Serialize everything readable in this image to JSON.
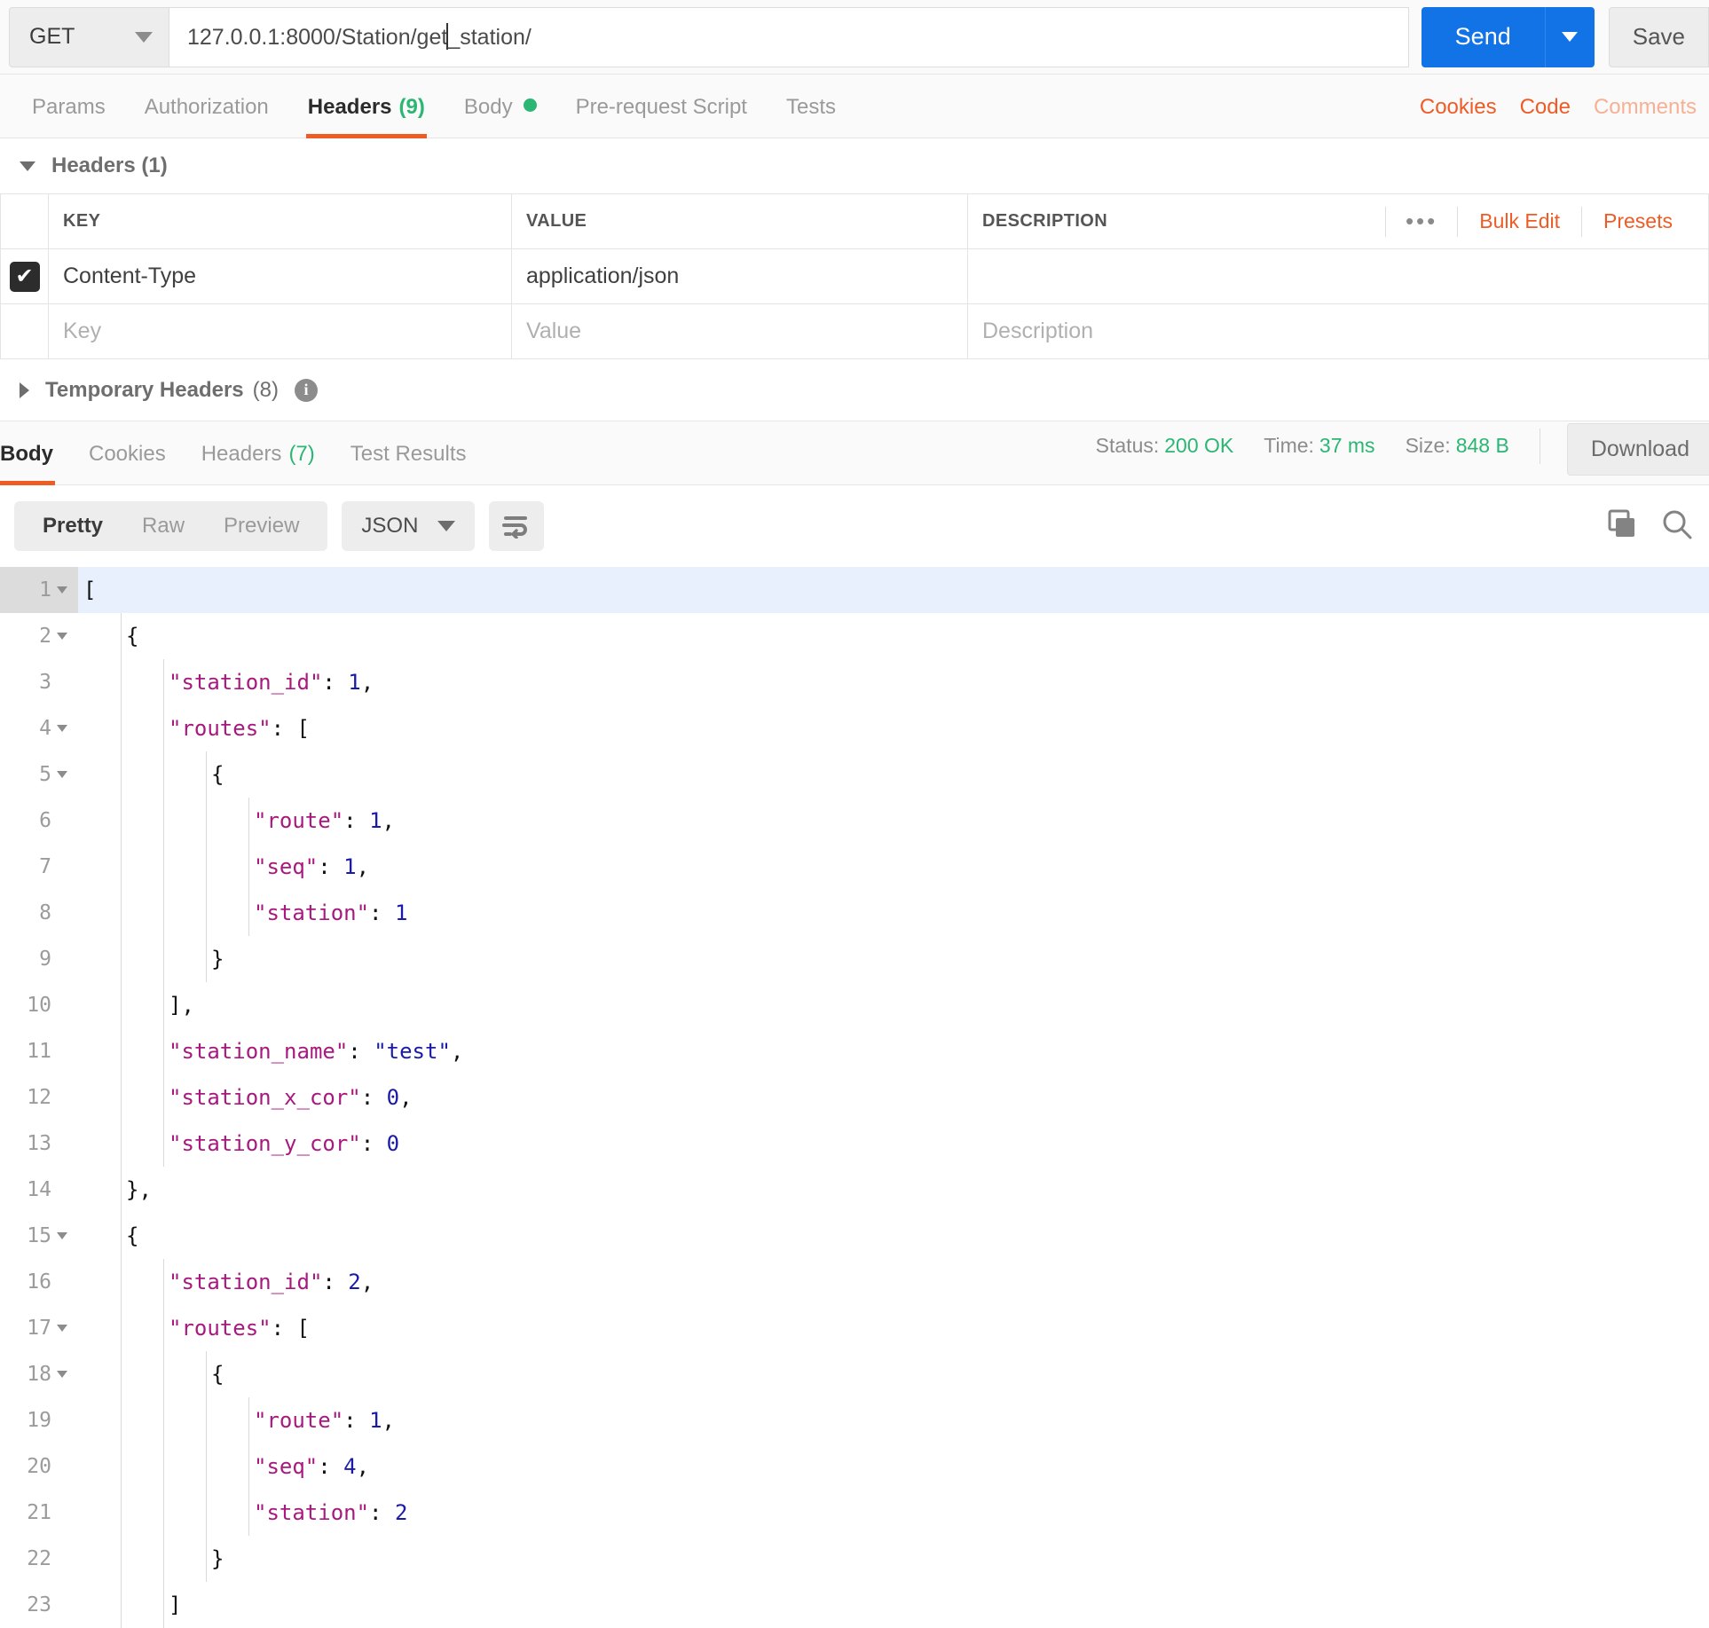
{
  "request": {
    "method": "GET",
    "url": "127.0.0.1:8000/Station/get_station/",
    "url_before_caret": "127.0.0.1:8000/Station/get",
    "url_after_caret": "_station/",
    "send_label": "Send",
    "save_label": "Save",
    "tabs": [
      {
        "label": "Params",
        "count": "",
        "active": false
      },
      {
        "label": "Authorization",
        "count": "",
        "active": false
      },
      {
        "label": "Headers",
        "count": "(9)",
        "active": true
      },
      {
        "label": "Body",
        "count": "",
        "active": false,
        "dot": true
      },
      {
        "label": "Pre-request Script",
        "count": "",
        "active": false
      },
      {
        "label": "Tests",
        "count": "",
        "active": false
      }
    ],
    "right_links": [
      {
        "label": "Cookies",
        "muted": false
      },
      {
        "label": "Code",
        "muted": false
      },
      {
        "label": "Comments",
        "muted": true
      }
    ]
  },
  "headers_section": {
    "title": "Headers (1)",
    "columns": [
      "KEY",
      "VALUE",
      "DESCRIPTION"
    ],
    "actions": {
      "more": "•••",
      "bulk_edit": "Bulk Edit",
      "presets": "Presets"
    },
    "rows": [
      {
        "checked": true,
        "key": "Content-Type",
        "value": "application/json",
        "description": ""
      }
    ],
    "placeholder_row": {
      "key": "Key",
      "value": "Value",
      "description": "Description"
    },
    "temporary_headers": {
      "label": "Temporary Headers",
      "count": "(8)"
    }
  },
  "response": {
    "tabs": [
      {
        "label": "Body",
        "count": "",
        "active": true
      },
      {
        "label": "Cookies",
        "count": "",
        "active": false
      },
      {
        "label": "Headers",
        "count": "(7)",
        "active": false
      },
      {
        "label": "Test Results",
        "count": "",
        "active": false
      }
    ],
    "meta": {
      "status_label": "Status:",
      "status_value": "200 OK",
      "time_label": "Time:",
      "time_value": "37 ms",
      "size_label": "Size:",
      "size_value": "848 B"
    },
    "download_label": "Download",
    "format_tabs": [
      {
        "label": "Pretty",
        "active": true
      },
      {
        "label": "Raw",
        "active": false
      },
      {
        "label": "Preview",
        "active": false
      }
    ],
    "language": "JSON",
    "accent_orange": "#ef5b25",
    "accent_blue": "#1173e6",
    "accent_green": "#2bb673",
    "body_lines": [
      {
        "num": "1",
        "fold": true,
        "highlight": true,
        "indent": 0,
        "tokens": [
          {
            "t": "[",
            "c": "p"
          }
        ]
      },
      {
        "num": "2",
        "fold": true,
        "highlight": false,
        "indent": 1,
        "tokens": [
          {
            "t": "{",
            "c": "p"
          }
        ]
      },
      {
        "num": "3",
        "fold": false,
        "highlight": false,
        "indent": 2,
        "tokens": [
          {
            "t": "\"station_id\"",
            "c": "k"
          },
          {
            "t": ": ",
            "c": "p"
          },
          {
            "t": "1",
            "c": "n"
          },
          {
            "t": ",",
            "c": "p"
          }
        ]
      },
      {
        "num": "4",
        "fold": true,
        "highlight": false,
        "indent": 2,
        "tokens": [
          {
            "t": "\"routes\"",
            "c": "k"
          },
          {
            "t": ": [",
            "c": "p"
          }
        ]
      },
      {
        "num": "5",
        "fold": true,
        "highlight": false,
        "indent": 3,
        "tokens": [
          {
            "t": "{",
            "c": "p"
          }
        ]
      },
      {
        "num": "6",
        "fold": false,
        "highlight": false,
        "indent": 4,
        "tokens": [
          {
            "t": "\"route\"",
            "c": "k"
          },
          {
            "t": ": ",
            "c": "p"
          },
          {
            "t": "1",
            "c": "n"
          },
          {
            "t": ",",
            "c": "p"
          }
        ]
      },
      {
        "num": "7",
        "fold": false,
        "highlight": false,
        "indent": 4,
        "tokens": [
          {
            "t": "\"seq\"",
            "c": "k"
          },
          {
            "t": ": ",
            "c": "p"
          },
          {
            "t": "1",
            "c": "n"
          },
          {
            "t": ",",
            "c": "p"
          }
        ]
      },
      {
        "num": "8",
        "fold": false,
        "highlight": false,
        "indent": 4,
        "tokens": [
          {
            "t": "\"station\"",
            "c": "k"
          },
          {
            "t": ": ",
            "c": "p"
          },
          {
            "t": "1",
            "c": "n"
          }
        ]
      },
      {
        "num": "9",
        "fold": false,
        "highlight": false,
        "indent": 3,
        "tokens": [
          {
            "t": "}",
            "c": "p"
          }
        ]
      },
      {
        "num": "10",
        "fold": false,
        "highlight": false,
        "indent": 2,
        "tokens": [
          {
            "t": "],",
            "c": "p"
          }
        ]
      },
      {
        "num": "11",
        "fold": false,
        "highlight": false,
        "indent": 2,
        "tokens": [
          {
            "t": "\"station_name\"",
            "c": "k"
          },
          {
            "t": ": ",
            "c": "p"
          },
          {
            "t": "\"test\"",
            "c": "s"
          },
          {
            "t": ",",
            "c": "p"
          }
        ]
      },
      {
        "num": "12",
        "fold": false,
        "highlight": false,
        "indent": 2,
        "tokens": [
          {
            "t": "\"station_x_cor\"",
            "c": "k"
          },
          {
            "t": ": ",
            "c": "p"
          },
          {
            "t": "0",
            "c": "n"
          },
          {
            "t": ",",
            "c": "p"
          }
        ]
      },
      {
        "num": "13",
        "fold": false,
        "highlight": false,
        "indent": 2,
        "tokens": [
          {
            "t": "\"station_y_cor\"",
            "c": "k"
          },
          {
            "t": ": ",
            "c": "p"
          },
          {
            "t": "0",
            "c": "n"
          }
        ]
      },
      {
        "num": "14",
        "fold": false,
        "highlight": false,
        "indent": 1,
        "tokens": [
          {
            "t": "},",
            "c": "p"
          }
        ]
      },
      {
        "num": "15",
        "fold": true,
        "highlight": false,
        "indent": 1,
        "tokens": [
          {
            "t": "{",
            "c": "p"
          }
        ]
      },
      {
        "num": "16",
        "fold": false,
        "highlight": false,
        "indent": 2,
        "tokens": [
          {
            "t": "\"station_id\"",
            "c": "k"
          },
          {
            "t": ": ",
            "c": "p"
          },
          {
            "t": "2",
            "c": "n"
          },
          {
            "t": ",",
            "c": "p"
          }
        ]
      },
      {
        "num": "17",
        "fold": true,
        "highlight": false,
        "indent": 2,
        "tokens": [
          {
            "t": "\"routes\"",
            "c": "k"
          },
          {
            "t": ": [",
            "c": "p"
          }
        ]
      },
      {
        "num": "18",
        "fold": true,
        "highlight": false,
        "indent": 3,
        "tokens": [
          {
            "t": "{",
            "c": "p"
          }
        ]
      },
      {
        "num": "19",
        "fold": false,
        "highlight": false,
        "indent": 4,
        "tokens": [
          {
            "t": "\"route\"",
            "c": "k"
          },
          {
            "t": ": ",
            "c": "p"
          },
          {
            "t": "1",
            "c": "n"
          },
          {
            "t": ",",
            "c": "p"
          }
        ]
      },
      {
        "num": "20",
        "fold": false,
        "highlight": false,
        "indent": 4,
        "tokens": [
          {
            "t": "\"seq\"",
            "c": "k"
          },
          {
            "t": ": ",
            "c": "p"
          },
          {
            "t": "4",
            "c": "n"
          },
          {
            "t": ",",
            "c": "p"
          }
        ]
      },
      {
        "num": "21",
        "fold": false,
        "highlight": false,
        "indent": 4,
        "tokens": [
          {
            "t": "\"station\"",
            "c": "k"
          },
          {
            "t": ": ",
            "c": "p"
          },
          {
            "t": "2",
            "c": "n"
          }
        ]
      },
      {
        "num": "22",
        "fold": false,
        "highlight": false,
        "indent": 3,
        "tokens": [
          {
            "t": "}",
            "c": "p"
          }
        ]
      },
      {
        "num": "23",
        "fold": false,
        "highlight": false,
        "indent": 2,
        "tokens": [
          {
            "t": "]",
            "c": "p"
          }
        ]
      }
    ]
  }
}
